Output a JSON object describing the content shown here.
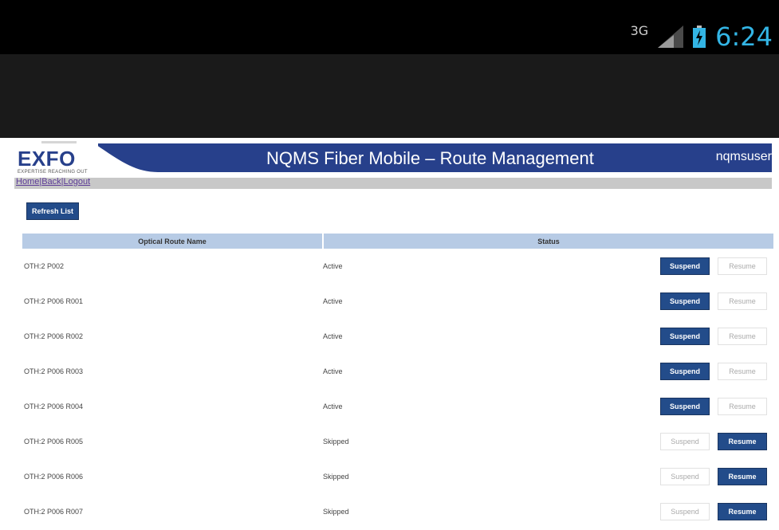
{
  "statusbar": {
    "network": "3G",
    "time": "6:24"
  },
  "browser": {
    "url": "https://192.168.132.14:8443/nqmsota/app/ro"
  },
  "colors": {
    "accent_blue": "#234c8a",
    "clock_blue": "#33b5e5",
    "table_header": "#b7cbe5"
  },
  "header": {
    "logo": "EXFO",
    "logo_tagline": "EXPERTISE REACHING OUT",
    "title": "NQMS Fiber Mobile – Route Management",
    "user": "nqmsuser"
  },
  "nav": {
    "home": "Home",
    "back": "Back",
    "logout": "Logout",
    "separator": "|"
  },
  "refresh_label": "Refresh List",
  "table": {
    "columns": [
      "Optical Route Name",
      "Status"
    ],
    "rows": [
      {
        "name": "OTH:2 P002",
        "status": "Active",
        "suspend": "Suspend",
        "resume": "Resume",
        "suspend_enabled": true,
        "resume_enabled": false
      },
      {
        "name": "OTH:2 P006 R001",
        "status": "Active",
        "suspend": "Suspend",
        "resume": "Resume",
        "suspend_enabled": true,
        "resume_enabled": false
      },
      {
        "name": "OTH:2 P006 R002",
        "status": "Active",
        "suspend": "Suspend",
        "resume": "Resume",
        "suspend_enabled": true,
        "resume_enabled": false
      },
      {
        "name": "OTH:2 P006 R003",
        "status": "Active",
        "suspend": "Suspend",
        "resume": "Resume",
        "suspend_enabled": true,
        "resume_enabled": false
      },
      {
        "name": "OTH:2 P006 R004",
        "status": "Active",
        "suspend": "Suspend",
        "resume": "Resume",
        "suspend_enabled": true,
        "resume_enabled": false
      },
      {
        "name": "OTH:2 P006 R005",
        "status": "Skipped",
        "suspend": "Suspend",
        "resume": "Resume",
        "suspend_enabled": false,
        "resume_enabled": true
      },
      {
        "name": "OTH:2 P006 R006",
        "status": "Skipped",
        "suspend": "Suspend",
        "resume": "Resume",
        "suspend_enabled": false,
        "resume_enabled": true
      },
      {
        "name": "OTH:2 P006 R007",
        "status": "Skipped",
        "suspend": "Suspend",
        "resume": "Resume",
        "suspend_enabled": false,
        "resume_enabled": true
      }
    ]
  },
  "icons": {
    "lock": "lock-icon",
    "menu": "menu-icon",
    "signal": "signal-icon",
    "battery": "battery-icon"
  }
}
